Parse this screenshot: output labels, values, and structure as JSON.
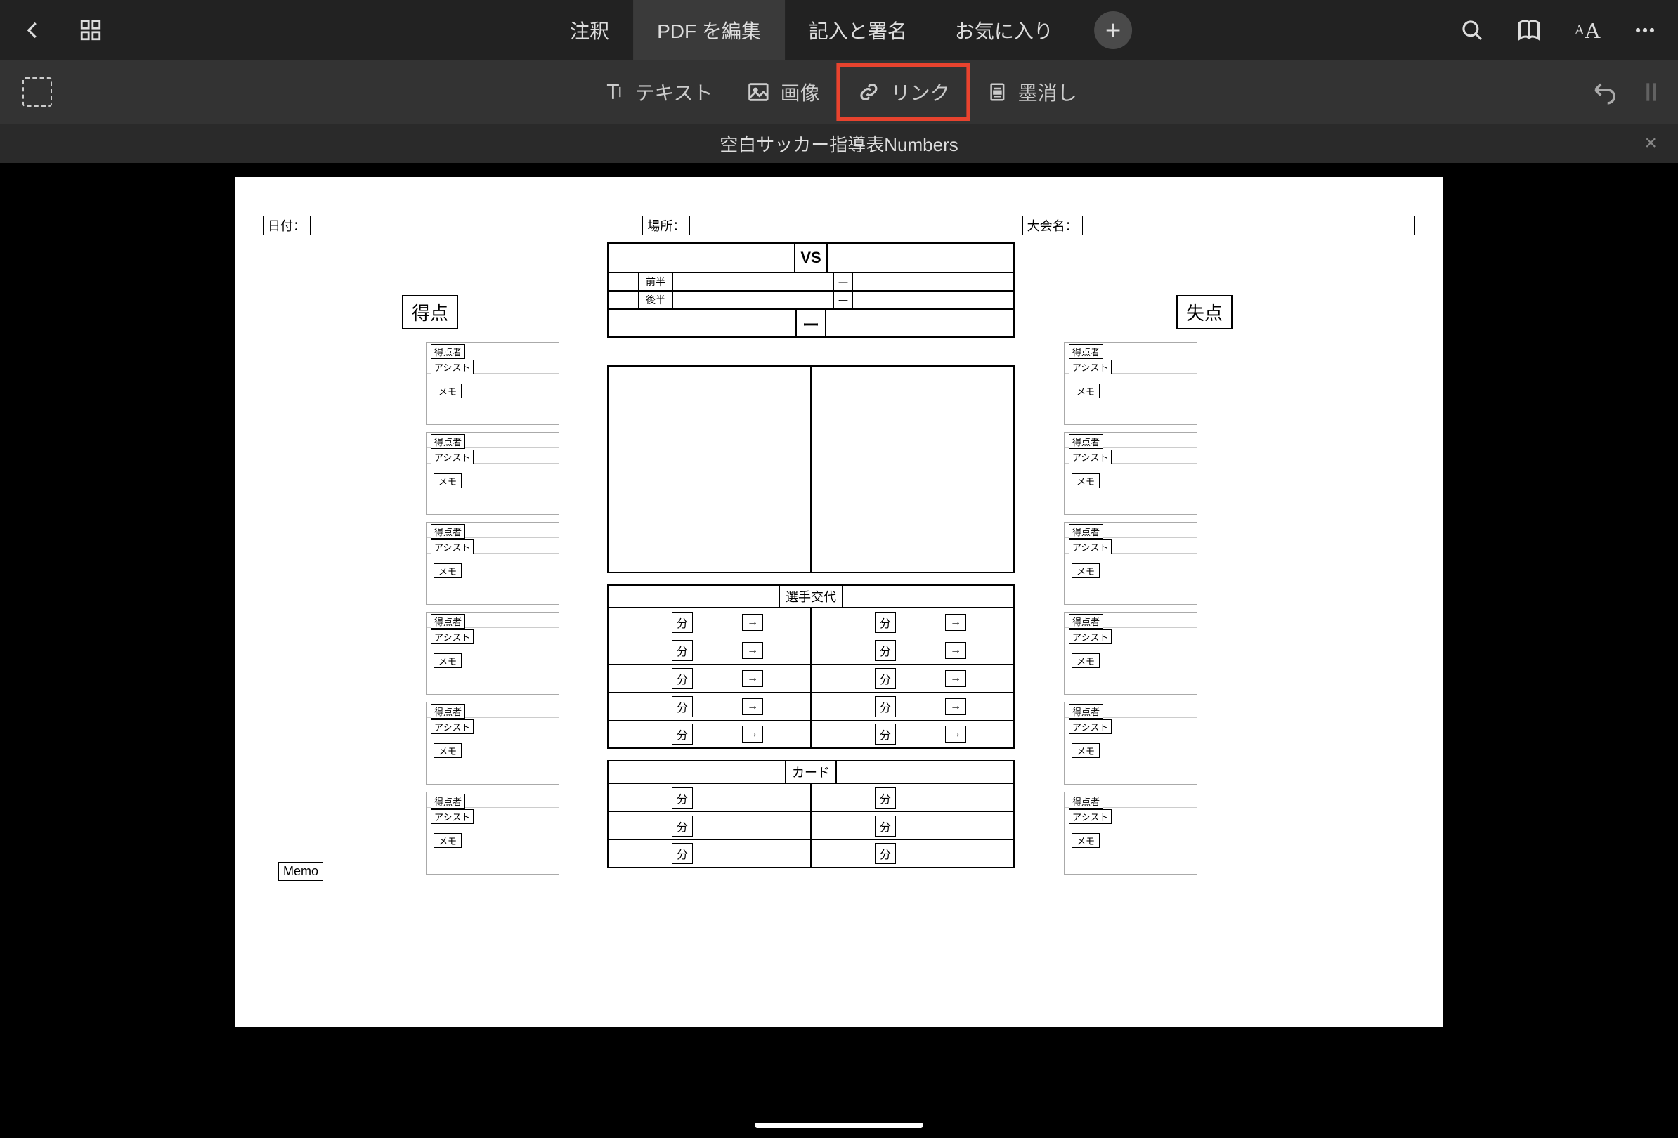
{
  "topbar": {
    "tabs": [
      "注釈",
      "PDF を編集",
      "記入と署名",
      "お気に入り"
    ],
    "active_tab_index": 1
  },
  "subbar": {
    "tools": [
      "テキスト",
      "画像",
      "リンク",
      "墨消し"
    ],
    "highlighted_index": 2
  },
  "document_title": "空白サッカー指導表Numbers",
  "page": {
    "header": {
      "date": "日付：",
      "place": "場所：",
      "tournament": "大会名："
    },
    "vs": {
      "label": "VS",
      "first_half": "前半",
      "second_half": "後半",
      "dash": "ー"
    },
    "score_left": "得点",
    "score_right": "失点",
    "score_card": {
      "scorer": "得点者",
      "assist": "アシスト",
      "memo": "メモ"
    },
    "substitution": {
      "title": "選手交代",
      "minute": "分",
      "arrow": "→"
    },
    "card": {
      "title": "カード",
      "minute": "分"
    },
    "memo_label": "Memo"
  }
}
